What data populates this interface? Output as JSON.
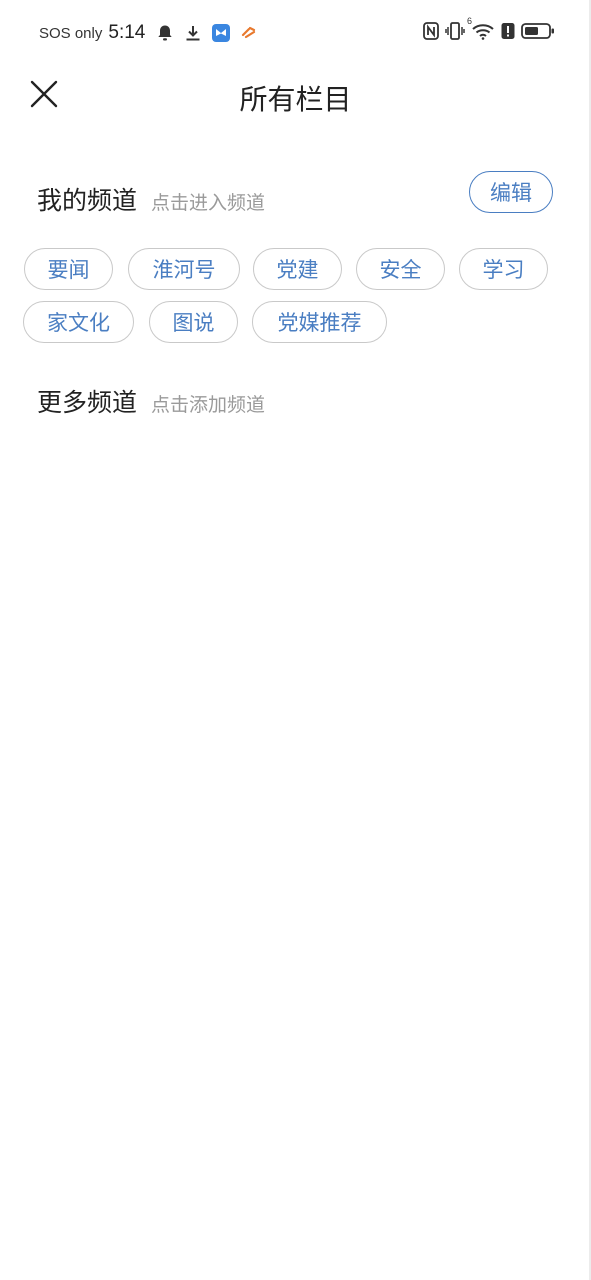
{
  "status_bar": {
    "carrier": "SOS only",
    "time": "5:14",
    "left_icons": [
      "bell-icon",
      "download-icon",
      "app-icon-blue",
      "app-icon-orange"
    ],
    "right_icons": [
      "nfc-icon",
      "vibrate-icon",
      "wifi-icon",
      "alert-icon",
      "battery-icon"
    ],
    "wifi_tag": "6"
  },
  "header": {
    "title": "所有栏目"
  },
  "my_channels": {
    "title": "我的频道",
    "hint": "点击进入频道",
    "edit_label": "编辑",
    "items": [
      "要闻",
      "淮河号",
      "党建",
      "安全",
      "学习",
      "家文化",
      "图说",
      "党媒推荐"
    ]
  },
  "more_channels": {
    "title": "更多频道",
    "hint": "点击添加频道"
  },
  "colors": {
    "accent": "#4a7ec2",
    "chip_border": "#c9c9c9",
    "hint": "#9a9a9a"
  }
}
